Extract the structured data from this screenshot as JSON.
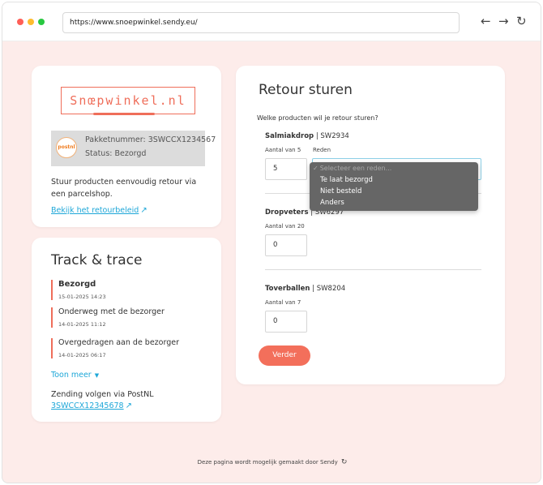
{
  "browser": {
    "url": "https://www.snoepwinkel.sendy.eu/",
    "back_icon": "←",
    "forward_icon": "→",
    "reload_icon": "↻"
  },
  "brand": {
    "logo_text": "Snœpwinkel.nl",
    "accent_color": "#ef6e5a",
    "link_color": "#1ea7d8"
  },
  "parcel": {
    "logo_text": "postnl",
    "number_label": "Pakketnummer: 3SWCCX1234567",
    "status_label": "Status: Bezorgd",
    "info_text": "Stuur producten eenvoudig retour via een parcelshop.",
    "policy_link": "Bekijk het retourbeleid"
  },
  "tracking": {
    "title": "Track & trace",
    "events": [
      {
        "status": "Bezorgd",
        "date": "15-01-2025 14:23"
      },
      {
        "status": "Onderweg met de bezorger",
        "date": "14-01-2025 11:12"
      },
      {
        "status": "Overgedragen aan de bezorger",
        "date": "14-01-2025 06:17"
      }
    ],
    "more_label": "Toon meer",
    "postnl_label": "Zending volgen via PostNL",
    "postnl_link": "3SWCCX12345678"
  },
  "return": {
    "title": "Retour sturen",
    "question": "Welke producten wil je retour sturen?",
    "reason_label": "Reden",
    "products": [
      {
        "name": "Salmiakdrop",
        "sku": " | SW2934",
        "qty_label": "Aantal van 5",
        "qty": "5"
      },
      {
        "name": "Dropveters",
        "sku": " | SW6297",
        "qty_label": "Aantal van 20",
        "qty": "0"
      },
      {
        "name": "Toverballen",
        "sku": " | SW8204",
        "qty_label": "Aantal van 7",
        "qty": "0"
      }
    ],
    "next_button": "Verder"
  },
  "reason_dropdown": {
    "placeholder": "Selecteer een reden...",
    "options": [
      "Te laat bezorgd",
      "Niet besteld",
      "Anders"
    ]
  },
  "footer": {
    "text": "Deze pagina wordt mogelijk gemaakt door Sendy"
  }
}
